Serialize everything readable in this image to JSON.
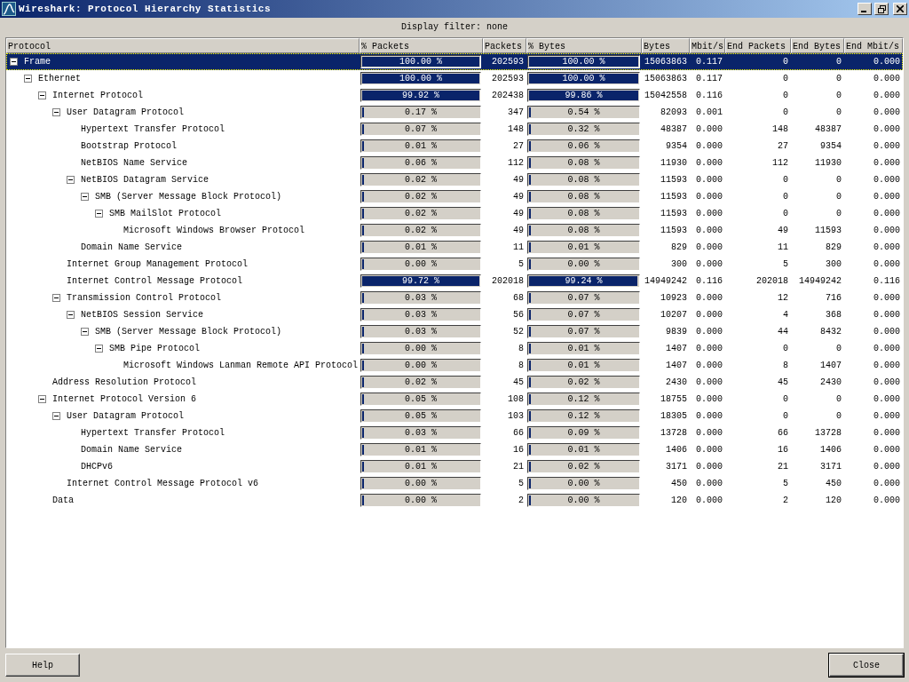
{
  "window": {
    "title": "Wireshark: Protocol Hierarchy Statistics"
  },
  "display_filter": "Display filter: none",
  "table": {
    "columns": [
      "Protocol",
      "% Packets",
      "Packets",
      "% Bytes",
      "Bytes",
      "Mbit/s",
      "End Packets",
      "End Bytes",
      "End Mbit/s"
    ],
    "rows": [
      {
        "protocol": "Frame",
        "selected": true,
        "expanded": true,
        "pct_packets": {
          "text": "100.00 %",
          "level": 1.0
        },
        "packets": "202593",
        "pct_bytes": {
          "text": "100.00 %",
          "level": 1.0
        },
        "bytes": "15063863",
        "mbit": "0.117",
        "end_packets": "0",
        "end_bytes": "0",
        "end_mbit": "0.000",
        "children": [
          {
            "protocol": "Ethernet",
            "selected": false,
            "expanded": true,
            "pct_packets": {
              "text": "100.00 %",
              "level": 1.0
            },
            "packets": "202593",
            "pct_bytes": {
              "text": "100.00 %",
              "level": 1.0
            },
            "bytes": "15063863",
            "mbit": "0.117",
            "end_packets": "0",
            "end_bytes": "0",
            "end_mbit": "0.000",
            "children": [
              {
                "protocol": "Internet Protocol",
                "selected": false,
                "expanded": true,
                "pct_packets": {
                  "text": "99.92 %",
                  "level": 0.9992
                },
                "packets": "202438",
                "pct_bytes": {
                  "text": "99.86 %",
                  "level": 0.9986
                },
                "bytes": "15042558",
                "mbit": "0.116",
                "end_packets": "0",
                "end_bytes": "0",
                "end_mbit": "0.000",
                "children": [
                  {
                    "protocol": "User Datagram Protocol",
                    "selected": false,
                    "expanded": true,
                    "pct_packets": {
                      "text": "0.17 %",
                      "level": 0.0017
                    },
                    "packets": "347",
                    "pct_bytes": {
                      "text": "0.54 %",
                      "level": 0.0054
                    },
                    "bytes": "82093",
                    "mbit": "0.001",
                    "end_packets": "0",
                    "end_bytes": "0",
                    "end_mbit": "0.000",
                    "children": [
                      {
                        "protocol": "Hypertext Transfer Protocol",
                        "selected": false,
                        "pct_packets": {
                          "text": "0.07 %",
                          "level": 0.0007
                        },
                        "packets": "148",
                        "pct_bytes": {
                          "text": "0.32 %",
                          "level": 0.0032
                        },
                        "bytes": "48387",
                        "mbit": "0.000",
                        "end_packets": "148",
                        "end_bytes": "48387",
                        "end_mbit": "0.000"
                      },
                      {
                        "protocol": "Bootstrap Protocol",
                        "selected": false,
                        "pct_packets": {
                          "text": "0.01 %",
                          "level": 0.0001
                        },
                        "packets": "27",
                        "pct_bytes": {
                          "text": "0.06 %",
                          "level": 0.0006
                        },
                        "bytes": "9354",
                        "mbit": "0.000",
                        "end_packets": "27",
                        "end_bytes": "9354",
                        "end_mbit": "0.000"
                      },
                      {
                        "protocol": "NetBIOS Name Service",
                        "selected": false,
                        "pct_packets": {
                          "text": "0.06 %",
                          "level": 0.0006
                        },
                        "packets": "112",
                        "pct_bytes": {
                          "text": "0.08 %",
                          "level": 0.0008
                        },
                        "bytes": "11930",
                        "mbit": "0.000",
                        "end_packets": "112",
                        "end_bytes": "11930",
                        "end_mbit": "0.000"
                      },
                      {
                        "protocol": "NetBIOS Datagram Service",
                        "selected": false,
                        "expanded": true,
                        "pct_packets": {
                          "text": "0.02 %",
                          "level": 0.0002
                        },
                        "packets": "49",
                        "pct_bytes": {
                          "text": "0.08 %",
                          "level": 0.0008
                        },
                        "bytes": "11593",
                        "mbit": "0.000",
                        "end_packets": "0",
                        "end_bytes": "0",
                        "end_mbit": "0.000",
                        "children": [
                          {
                            "protocol": "SMB (Server Message Block Protocol)",
                            "selected": false,
                            "expanded": true,
                            "pct_packets": {
                              "text": "0.02 %",
                              "level": 0.0002
                            },
                            "packets": "49",
                            "pct_bytes": {
                              "text": "0.08 %",
                              "level": 0.0008
                            },
                            "bytes": "11593",
                            "mbit": "0.000",
                            "end_packets": "0",
                            "end_bytes": "0",
                            "end_mbit": "0.000",
                            "children": [
                              {
                                "protocol": "SMB MailSlot Protocol",
                                "selected": false,
                                "expanded": true,
                                "pct_packets": {
                                  "text": "0.02 %",
                                  "level": 0.0002
                                },
                                "packets": "49",
                                "pct_bytes": {
                                  "text": "0.08 %",
                                  "level": 0.0008
                                },
                                "bytes": "11593",
                                "mbit": "0.000",
                                "end_packets": "0",
                                "end_bytes": "0",
                                "end_mbit": "0.000",
                                "children": [
                                  {
                                    "protocol": "Microsoft Windows Browser Protocol",
                                    "selected": false,
                                    "pct_packets": {
                                      "text": "0.02 %",
                                      "level": 0.0002
                                    },
                                    "packets": "49",
                                    "pct_bytes": {
                                      "text": "0.08 %",
                                      "level": 0.0008
                                    },
                                    "bytes": "11593",
                                    "mbit": "0.000",
                                    "end_packets": "49",
                                    "end_bytes": "11593",
                                    "end_mbit": "0.000"
                                  }
                                ]
                              }
                            ]
                          }
                        ]
                      },
                      {
                        "protocol": "Domain Name Service",
                        "selected": false,
                        "pct_packets": {
                          "text": "0.01 %",
                          "level": 0.0001
                        },
                        "packets": "11",
                        "pct_bytes": {
                          "text": "0.01 %",
                          "level": 0.0001
                        },
                        "bytes": "829",
                        "mbit": "0.000",
                        "end_packets": "11",
                        "end_bytes": "829",
                        "end_mbit": "0.000"
                      }
                    ]
                  },
                  {
                    "protocol": "Internet Group Management Protocol",
                    "selected": false,
                    "pct_packets": {
                      "text": "0.00 %",
                      "level": 0.0
                    },
                    "packets": "5",
                    "pct_bytes": {
                      "text": "0.00 %",
                      "level": 0.0
                    },
                    "bytes": "300",
                    "mbit": "0.000",
                    "end_packets": "5",
                    "end_bytes": "300",
                    "end_mbit": "0.000"
                  },
                  {
                    "protocol": "Internet Control Message Protocol",
                    "selected": false,
                    "pct_packets": {
                      "text": "99.72 %",
                      "level": 0.9972
                    },
                    "packets": "202018",
                    "pct_bytes": {
                      "text": "99.24 %",
                      "level": 0.9924
                    },
                    "bytes": "14949242",
                    "mbit": "0.116",
                    "end_packets": "202018",
                    "end_bytes": "14949242",
                    "end_mbit": "0.116"
                  },
                  {
                    "protocol": "Transmission Control Protocol",
                    "selected": false,
                    "expanded": true,
                    "pct_packets": {
                      "text": "0.03 %",
                      "level": 0.0003
                    },
                    "packets": "68",
                    "pct_bytes": {
                      "text": "0.07 %",
                      "level": 0.0007
                    },
                    "bytes": "10923",
                    "mbit": "0.000",
                    "end_packets": "12",
                    "end_bytes": "716",
                    "end_mbit": "0.000",
                    "children": [
                      {
                        "protocol": "NetBIOS Session Service",
                        "selected": false,
                        "expanded": true,
                        "pct_packets": {
                          "text": "0.03 %",
                          "level": 0.0003
                        },
                        "packets": "56",
                        "pct_bytes": {
                          "text": "0.07 %",
                          "level": 0.0007
                        },
                        "bytes": "10207",
                        "mbit": "0.000",
                        "end_packets": "4",
                        "end_bytes": "368",
                        "end_mbit": "0.000",
                        "children": [
                          {
                            "protocol": "SMB (Server Message Block Protocol)",
                            "selected": false,
                            "expanded": true,
                            "pct_packets": {
                              "text": "0.03 %",
                              "level": 0.0003
                            },
                            "packets": "52",
                            "pct_bytes": {
                              "text": "0.07 %",
                              "level": 0.0007
                            },
                            "bytes": "9839",
                            "mbit": "0.000",
                            "end_packets": "44",
                            "end_bytes": "8432",
                            "end_mbit": "0.000",
                            "children": [
                              {
                                "protocol": "SMB Pipe Protocol",
                                "selected": false,
                                "expanded": true,
                                "pct_packets": {
                                  "text": "0.00 %",
                                  "level": 0.0
                                },
                                "packets": "8",
                                "pct_bytes": {
                                  "text": "0.01 %",
                                  "level": 0.0001
                                },
                                "bytes": "1407",
                                "mbit": "0.000",
                                "end_packets": "0",
                                "end_bytes": "0",
                                "end_mbit": "0.000",
                                "children": [
                                  {
                                    "protocol": "Microsoft Windows Lanman Remote API Protocol",
                                    "selected": false,
                                    "pct_packets": {
                                      "text": "0.00 %",
                                      "level": 0.0
                                    },
                                    "packets": "8",
                                    "pct_bytes": {
                                      "text": "0.01 %",
                                      "level": 0.0001
                                    },
                                    "bytes": "1407",
                                    "mbit": "0.000",
                                    "end_packets": "8",
                                    "end_bytes": "1407",
                                    "end_mbit": "0.000"
                                  }
                                ]
                              }
                            ]
                          }
                        ]
                      }
                    ]
                  }
                ]
              },
              {
                "protocol": "Address Resolution Protocol",
                "selected": false,
                "pct_packets": {
                  "text": "0.02 %",
                  "level": 0.0002
                },
                "packets": "45",
                "pct_bytes": {
                  "text": "0.02 %",
                  "level": 0.0002
                },
                "bytes": "2430",
                "mbit": "0.000",
                "end_packets": "45",
                "end_bytes": "2430",
                "end_mbit": "0.000"
              },
              {
                "protocol": "Internet Protocol Version 6",
                "selected": false,
                "expanded": true,
                "pct_packets": {
                  "text": "0.05 %",
                  "level": 0.0005
                },
                "packets": "108",
                "pct_bytes": {
                  "text": "0.12 %",
                  "level": 0.0012
                },
                "bytes": "18755",
                "mbit": "0.000",
                "end_packets": "0",
                "end_bytes": "0",
                "end_mbit": "0.000",
                "children": [
                  {
                    "protocol": "User Datagram Protocol",
                    "selected": false,
                    "expanded": true,
                    "pct_packets": {
                      "text": "0.05 %",
                      "level": 0.0005
                    },
                    "packets": "103",
                    "pct_bytes": {
                      "text": "0.12 %",
                      "level": 0.0012
                    },
                    "bytes": "18305",
                    "mbit": "0.000",
                    "end_packets": "0",
                    "end_bytes": "0",
                    "end_mbit": "0.000",
                    "children": [
                      {
                        "protocol": "Hypertext Transfer Protocol",
                        "selected": false,
                        "pct_packets": {
                          "text": "0.03 %",
                          "level": 0.0003
                        },
                        "packets": "66",
                        "pct_bytes": {
                          "text": "0.09 %",
                          "level": 0.0009
                        },
                        "bytes": "13728",
                        "mbit": "0.000",
                        "end_packets": "66",
                        "end_bytes": "13728",
                        "end_mbit": "0.000"
                      },
                      {
                        "protocol": "Domain Name Service",
                        "selected": false,
                        "pct_packets": {
                          "text": "0.01 %",
                          "level": 0.0001
                        },
                        "packets": "16",
                        "pct_bytes": {
                          "text": "0.01 %",
                          "level": 0.0001
                        },
                        "bytes": "1406",
                        "mbit": "0.000",
                        "end_packets": "16",
                        "end_bytes": "1406",
                        "end_mbit": "0.000"
                      },
                      {
                        "protocol": "DHCPv6",
                        "selected": false,
                        "pct_packets": {
                          "text": "0.01 %",
                          "level": 0.0001
                        },
                        "packets": "21",
                        "pct_bytes": {
                          "text": "0.02 %",
                          "level": 0.0002
                        },
                        "bytes": "3171",
                        "mbit": "0.000",
                        "end_packets": "21",
                        "end_bytes": "3171",
                        "end_mbit": "0.000"
                      }
                    ]
                  },
                  {
                    "protocol": "Internet Control Message Protocol v6",
                    "selected": false,
                    "pct_packets": {
                      "text": "0.00 %",
                      "level": 0.0
                    },
                    "packets": "5",
                    "pct_bytes": {
                      "text": "0.00 %",
                      "level": 0.0
                    },
                    "bytes": "450",
                    "mbit": "0.000",
                    "end_packets": "5",
                    "end_bytes": "450",
                    "end_mbit": "0.000"
                  }
                ]
              },
              {
                "protocol": "Data",
                "selected": false,
                "pct_packets": {
                  "text": "0.00 %",
                  "level": 0.0
                },
                "packets": "2",
                "pct_bytes": {
                  "text": "0.00 %",
                  "level": 0.0
                },
                "bytes": "120",
                "mbit": "0.000",
                "end_packets": "2",
                "end_bytes": "120",
                "end_mbit": "0.000"
              }
            ]
          }
        ]
      }
    ]
  },
  "buttons": [
    {
      "label": "Help"
    },
    {
      "label": "Close"
    }
  ]
}
